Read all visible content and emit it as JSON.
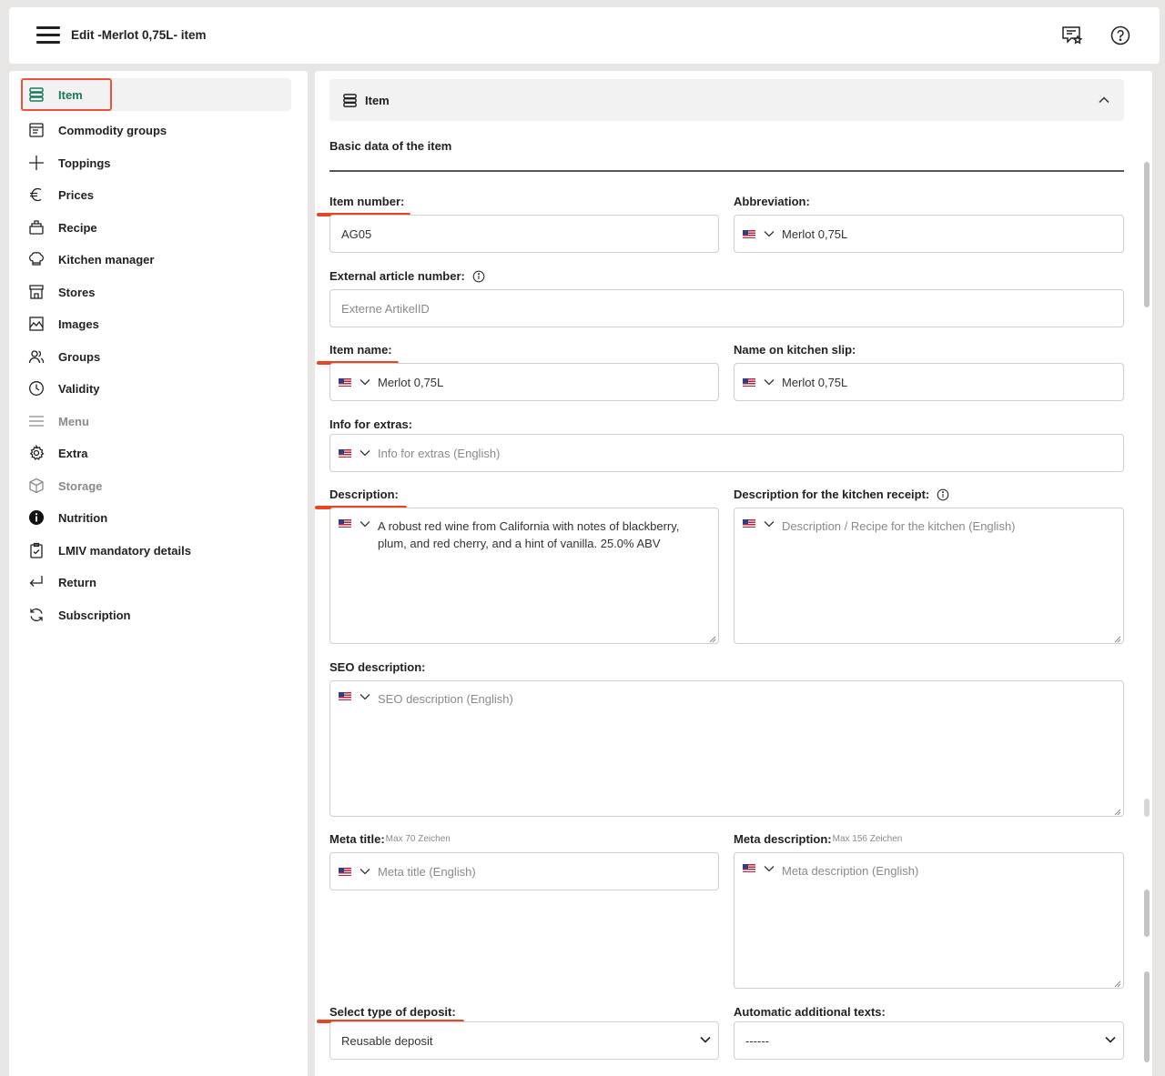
{
  "header": {
    "title": "Edit -Merlot 0,75L- item",
    "icons": [
      "menu-icon",
      "feedback-icon",
      "help-icon"
    ]
  },
  "sidebar": {
    "items": [
      {
        "label": "Item",
        "icon": "item-icon",
        "active": true
      },
      {
        "label": "Commodity groups",
        "icon": "commodity-groups-icon"
      },
      {
        "label": "Toppings",
        "icon": "plus-icon"
      },
      {
        "label": "Prices",
        "icon": "euro-icon"
      },
      {
        "label": "Recipe",
        "icon": "recipe-icon"
      },
      {
        "label": "Kitchen manager",
        "icon": "chef-hat-icon"
      },
      {
        "label": "Stores",
        "icon": "store-icon"
      },
      {
        "label": "Images",
        "icon": "image-icon"
      },
      {
        "label": "Groups",
        "icon": "users-icon"
      },
      {
        "label": "Validity",
        "icon": "clock-icon"
      },
      {
        "label": "Menu",
        "icon": "menu-lines-icon",
        "disabled": true
      },
      {
        "label": "Extra",
        "icon": "gear-icon"
      },
      {
        "label": "Storage",
        "icon": "box-icon",
        "disabled": true
      },
      {
        "label": "Nutrition",
        "icon": "info-filled-icon"
      },
      {
        "label": "LMIV mandatory details",
        "icon": "clipboard-check-icon"
      },
      {
        "label": "Return",
        "icon": "return-icon"
      },
      {
        "label": "Subscription",
        "icon": "refresh-icon"
      }
    ]
  },
  "section": {
    "title": "Item",
    "subtitle": "Basic data of the item"
  },
  "form": {
    "item_number": {
      "label": "Item number:",
      "value": "AG05"
    },
    "abbreviation": {
      "label": "Abbreviation:",
      "value": "Merlot 0,75L"
    },
    "external_article_number": {
      "label": "External article number:",
      "placeholder": "Externe ArtikelID"
    },
    "item_name": {
      "label": "Item name:",
      "value": "Merlot 0,75L"
    },
    "kitchen_slip_name": {
      "label": "Name on kitchen slip:",
      "value": "Merlot 0,75L"
    },
    "info_for_extras": {
      "label": "Info for extras:",
      "placeholder": "Info for extras (English)"
    },
    "description": {
      "label": "Description:",
      "value": "A robust red wine from California with notes of blackberry, plum, and red cherry, and a hint of vanilla. 25.0% ABV"
    },
    "kitchen_receipt_description": {
      "label": "Description for the kitchen receipt:",
      "placeholder": "Description / Recipe for the kitchen (English)"
    },
    "seo_description": {
      "label": "SEO description:",
      "placeholder": "SEO description (English)"
    },
    "meta_title": {
      "label": "Meta title:",
      "hint": "Max 70 Zeichen",
      "placeholder": "Meta title (English)"
    },
    "meta_description": {
      "label": "Meta description:",
      "hint": "Max 156 Zeichen",
      "placeholder": "Meta description (English)"
    },
    "deposit_type": {
      "label": "Select type of deposit:",
      "value": "Reusable deposit"
    },
    "additional_texts": {
      "label": "Automatic additional texts:",
      "value": "------"
    }
  },
  "colors": {
    "accent": "#1a7a5c",
    "highlight": "#e8461e",
    "background": "#e8e6e4"
  }
}
